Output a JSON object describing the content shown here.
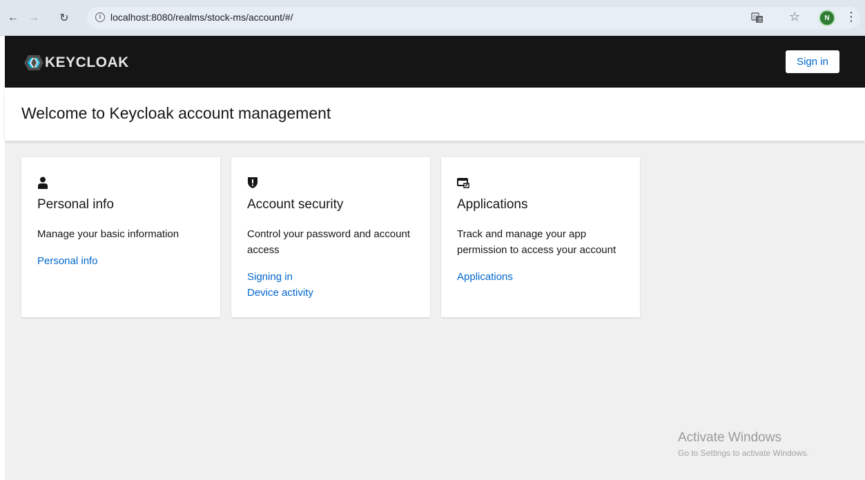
{
  "browser": {
    "url": "localhost:8080/realms/stock-ms/account/#/",
    "avatar_initial": "N"
  },
  "header": {
    "brand": "KEYCLOAK",
    "signin_label": "Sign in"
  },
  "page": {
    "title": "Welcome to Keycloak account management"
  },
  "cards": [
    {
      "icon": "user-icon",
      "title": "Personal info",
      "description": "Manage your basic information",
      "links": [
        "Personal info"
      ]
    },
    {
      "icon": "shield-icon",
      "title": "Account security",
      "description": "Control your password and account access",
      "links": [
        "Signing in",
        "Device activity"
      ]
    },
    {
      "icon": "applications-icon",
      "title": "Applications",
      "description": "Track and manage your app permission to access your account",
      "links": [
        "Applications"
      ]
    }
  ],
  "watermark": {
    "title": "Activate Windows",
    "subtitle": "Go to Settings to activate Windows."
  },
  "colors": {
    "header_bg": "#151515",
    "link": "#0066cc",
    "page_bg": "#f0f0f0"
  }
}
